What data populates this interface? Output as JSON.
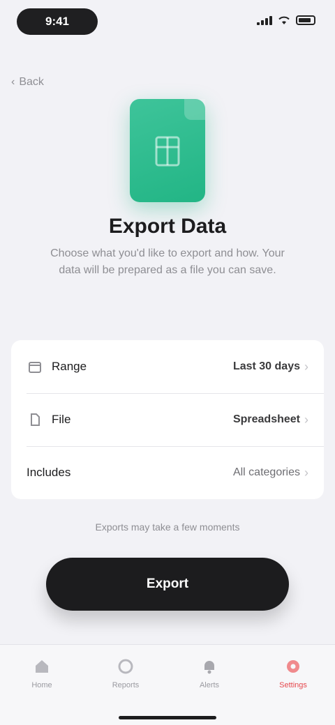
{
  "status_bar": {
    "time": "9:41"
  },
  "nav": {
    "back_label": "Back"
  },
  "hero": {
    "title": "Export Data",
    "description": "Choose what you'd like to export and how. Your data will be prepared as a file you can save."
  },
  "options": [
    {
      "icon": "calendar-icon",
      "label": "Range",
      "value": "Last 30 days"
    },
    {
      "icon": "file-icon",
      "label": "File",
      "value": "Spreadsheet"
    },
    {
      "icon": "",
      "label": "Includes",
      "value": "All categories"
    }
  ],
  "note": "Exports may take a few moments",
  "primary_button": "Export",
  "tab_bar": [
    {
      "icon": "home-icon",
      "label": "Home",
      "active": false
    },
    {
      "icon": "chart-icon",
      "label": "Reports",
      "active": false
    },
    {
      "icon": "bell-icon",
      "label": "Alerts",
      "active": false
    },
    {
      "icon": "settings-icon",
      "label": "Settings",
      "active": true
    }
  ],
  "colors": {
    "accent": "#22b585",
    "active_tab": "#e5484d",
    "button": "#1c1c1e"
  }
}
